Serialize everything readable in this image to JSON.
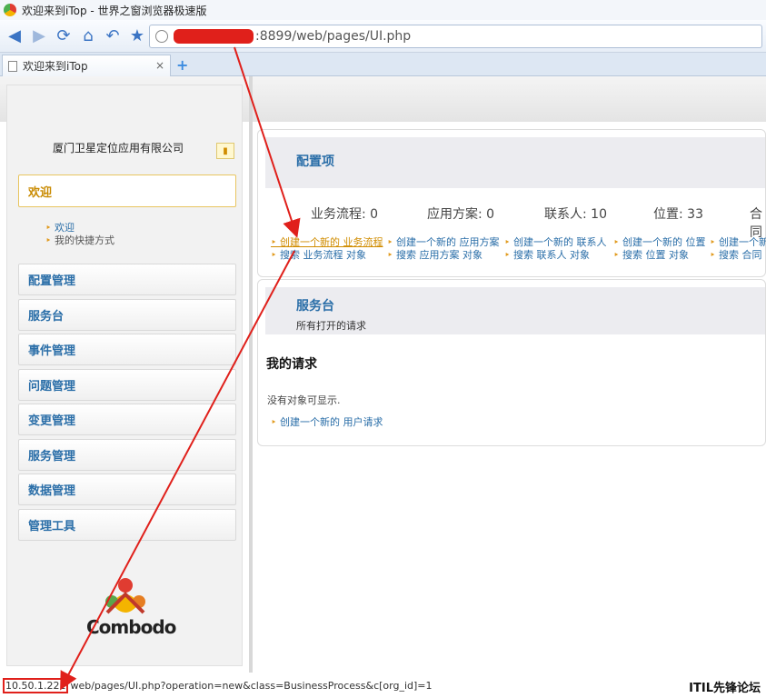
{
  "window": {
    "title": "欢迎来到iTop - 世界之窗浏览器极速版"
  },
  "toolbar": {
    "address_url": ":8899/web/pages/UI.php"
  },
  "tabs": {
    "active_label": "欢迎来到iTop",
    "close_glyph": "×",
    "new_tab_glyph": "+"
  },
  "sidebar": {
    "company": "厦门卫星定位应用有限公司",
    "pin_icon": "pin-icon",
    "menu": [
      {
        "label": "欢迎",
        "active": true
      },
      {
        "label": "配置管理"
      },
      {
        "label": "服务台"
      },
      {
        "label": "事件管理"
      },
      {
        "label": "问题管理"
      },
      {
        "label": "变更管理"
      },
      {
        "label": "服务管理"
      },
      {
        "label": "数据管理"
      },
      {
        "label": "管理工具"
      }
    ],
    "welcome_sub": [
      "欢迎",
      "我的快捷方式"
    ],
    "logo_text": "Combodo"
  },
  "config_panel": {
    "title": "配置项",
    "stats": [
      {
        "label": "业务流程: 0"
      },
      {
        "label": "应用方案: 0"
      },
      {
        "label": "联系人: 10"
      },
      {
        "label": "位置: 33"
      },
      {
        "label": "合同"
      }
    ],
    "create_links": [
      "创建一个新的 业务流程",
      "创建一个新的 应用方案",
      "创建一个新的 联系人",
      "创建一个新的 位置",
      "创建一个新"
    ],
    "search_links": [
      "搜索 业务流程 对象",
      "搜索 应用方案 对象",
      "搜索 联系人 对象",
      "搜索 位置 对象",
      "搜索 合同"
    ]
  },
  "service_panel": {
    "title": "服务台",
    "subtitle": "所有打开的请求",
    "my_requests": "我的请求",
    "no_objects": "没有对象可显示.",
    "new_request_link": "创建一个新的 用户请求"
  },
  "statusbar": {
    "ip": "10.50.1.221",
    "url": "web/pages/UI.php?operation=new&class=BusinessProcess&c[org_id]=1",
    "watermark": "ITIL先锋论坛"
  },
  "colors": {
    "link_blue": "#2a6ea8",
    "highlight_orange": "#d08c00",
    "annotation_red": "#e0201b"
  }
}
